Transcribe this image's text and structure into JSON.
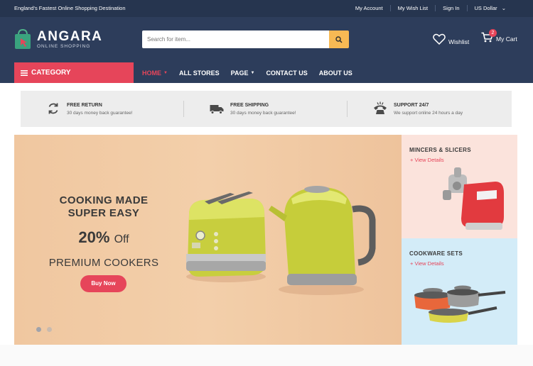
{
  "topbar": {
    "tagline": "England's Fastest Online Shopping Destination",
    "links": [
      "My Account",
      "My Wish List",
      "Sign In",
      "US Dollar"
    ]
  },
  "logo": {
    "name": "ANGARA",
    "subtitle": "ONLINE SHOPPING"
  },
  "search": {
    "placeholder": "Search for item..."
  },
  "header_actions": {
    "wishlist": "Wishlist",
    "cart": "My Cart",
    "cart_count": "2"
  },
  "nav": {
    "category": "CATEGORY",
    "items": [
      {
        "label": "HOME",
        "active": true,
        "dropdown": true
      },
      {
        "label": "ALL STORES",
        "active": false,
        "dropdown": false
      },
      {
        "label": "PAGE",
        "active": false,
        "dropdown": true
      },
      {
        "label": "CONTACT US",
        "active": false,
        "dropdown": false
      },
      {
        "label": "ABOUT US",
        "active": false,
        "dropdown": false
      }
    ]
  },
  "features": [
    {
      "icon": "refresh-icon",
      "title": "FREE RETURN",
      "subtitle": "30 days money back guarantee!"
    },
    {
      "icon": "truck-icon",
      "title": "FREE SHIPPING",
      "subtitle": "30 days money back guarantee!"
    },
    {
      "icon": "phone-icon",
      "title": "SUPPORT 24/7",
      "subtitle": "We support online 24 hours a day"
    }
  ],
  "hero": {
    "headline_line1": "COOKING MADE",
    "headline_line2": "SUPER EASY",
    "discount": "20%",
    "discount_suffix": "Off",
    "subtitle": "PREMIUM COOKERS",
    "cta": "Buy Now"
  },
  "side_banners": [
    {
      "title": "MINCERS & SLICERS",
      "link": "+ View Details"
    },
    {
      "title": "COOKWARE SETS",
      "link": "+ View Details"
    }
  ],
  "colors": {
    "topbar": "#26354f",
    "header": "#2d3d5b",
    "accent": "#e6455a",
    "search_button": "#f7b954",
    "features_bg": "#ededed",
    "hero_bg": "#f0c7a0",
    "side1_bg": "#fbe3dc",
    "side2_bg": "#d3ecf8"
  }
}
